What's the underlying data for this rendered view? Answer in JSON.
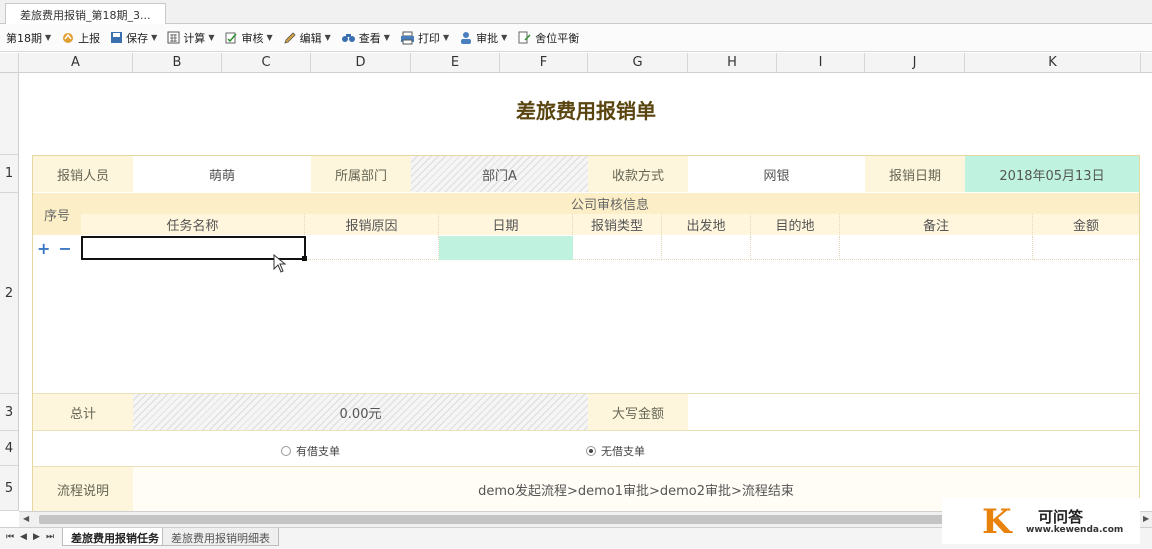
{
  "window": {
    "doc_tab": "差旅费用报销_第18期_3..."
  },
  "toolbar": {
    "period": "第18期",
    "upload": "上报",
    "save": "保存",
    "calc": "计算",
    "audit": "审核",
    "edit": "编辑",
    "view": "查看",
    "print": "打印",
    "approve": "审批",
    "balance": "舍位平衡"
  },
  "grid": {
    "columns": [
      "A",
      "B",
      "C",
      "D",
      "E",
      "F",
      "G",
      "H",
      "I",
      "J",
      "K"
    ],
    "rows": [
      "1",
      "2",
      "3",
      "4",
      "5"
    ]
  },
  "form": {
    "title": "差旅费用报销单",
    "row1": {
      "applicant_label": "报销人员",
      "applicant": "萌萌",
      "dept_label": "所属部门",
      "dept": "部门A",
      "pay_label": "收款方式",
      "pay": "网银",
      "date_label": "报销日期",
      "date": "2018年05月13日"
    },
    "detail": {
      "seq_label": "序号",
      "group_label": "公司审核信息",
      "columns": [
        "任务名称",
        "报销原因",
        "日期",
        "报销类型",
        "出发地",
        "目的地",
        "备注",
        "金额"
      ],
      "add": "+",
      "remove": "−"
    },
    "total": {
      "label": "总计",
      "value": "0.00元",
      "uppercase_label": "大写金额",
      "uppercase_value": ""
    },
    "loan": {
      "option_yes": "有借支单",
      "option_no": "无借支单",
      "selected": "无借支单"
    },
    "process": {
      "label": "流程说明",
      "text": "demo发起流程>demo1审批>demo2审批>流程结束"
    }
  },
  "sheets": {
    "tabs": [
      "差旅费用报销任务",
      "差旅费用报销明细表"
    ],
    "active": "差旅费用报销任务"
  },
  "watermark": {
    "letter": "K",
    "name": "可问答",
    "url": "www.kewenda.com"
  },
  "colors": {
    "accent_label": "#fdf6dc",
    "highlight": "#bff3df",
    "title": "#5a4510"
  }
}
